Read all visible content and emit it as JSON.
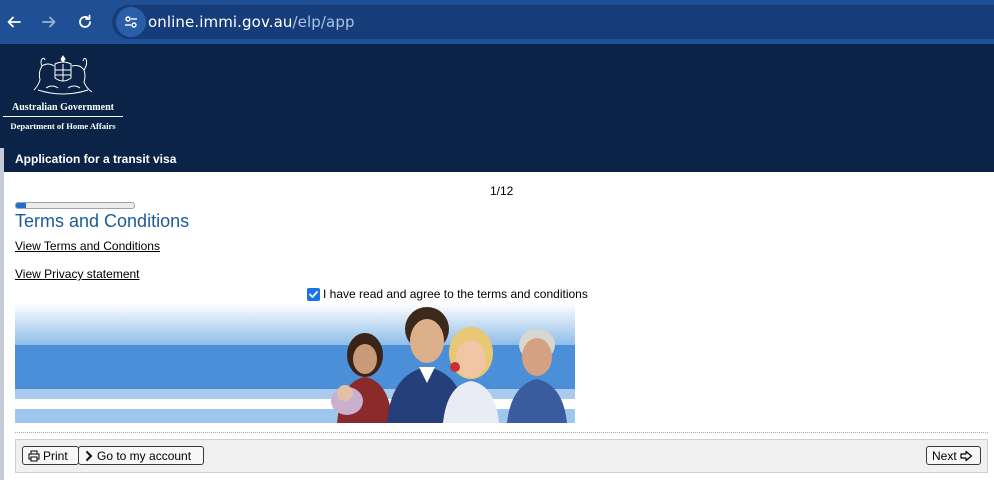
{
  "browser": {
    "url_host": "online.immi.gov.au",
    "url_path": "/elp/app",
    "icons": [
      "back-arrow-icon",
      "forward-arrow-icon",
      "reload-icon",
      "site-info-icon"
    ]
  },
  "header": {
    "gov_name": "Australian Government",
    "dept_name": "Department of Home Affairs",
    "app_title": "Application for a transit visa"
  },
  "progress": {
    "page_label": "1/12",
    "fraction": 0.083
  },
  "main": {
    "section_title": "Terms and Conditions",
    "terms_link": "View Terms and Conditions",
    "privacy_link": "View Privacy statement",
    "agree_label": "I have read and agree to the terms and conditions",
    "agree_checked": true
  },
  "footer": {
    "print_label": "Print",
    "account_label": "Go to my account",
    "next_label": "Next"
  },
  "colors": {
    "browser_bar": "#1f4f94",
    "header_bg": "#0b2346",
    "title_blue": "#1d5a9b",
    "progress_fill": "#1e6fd0"
  }
}
